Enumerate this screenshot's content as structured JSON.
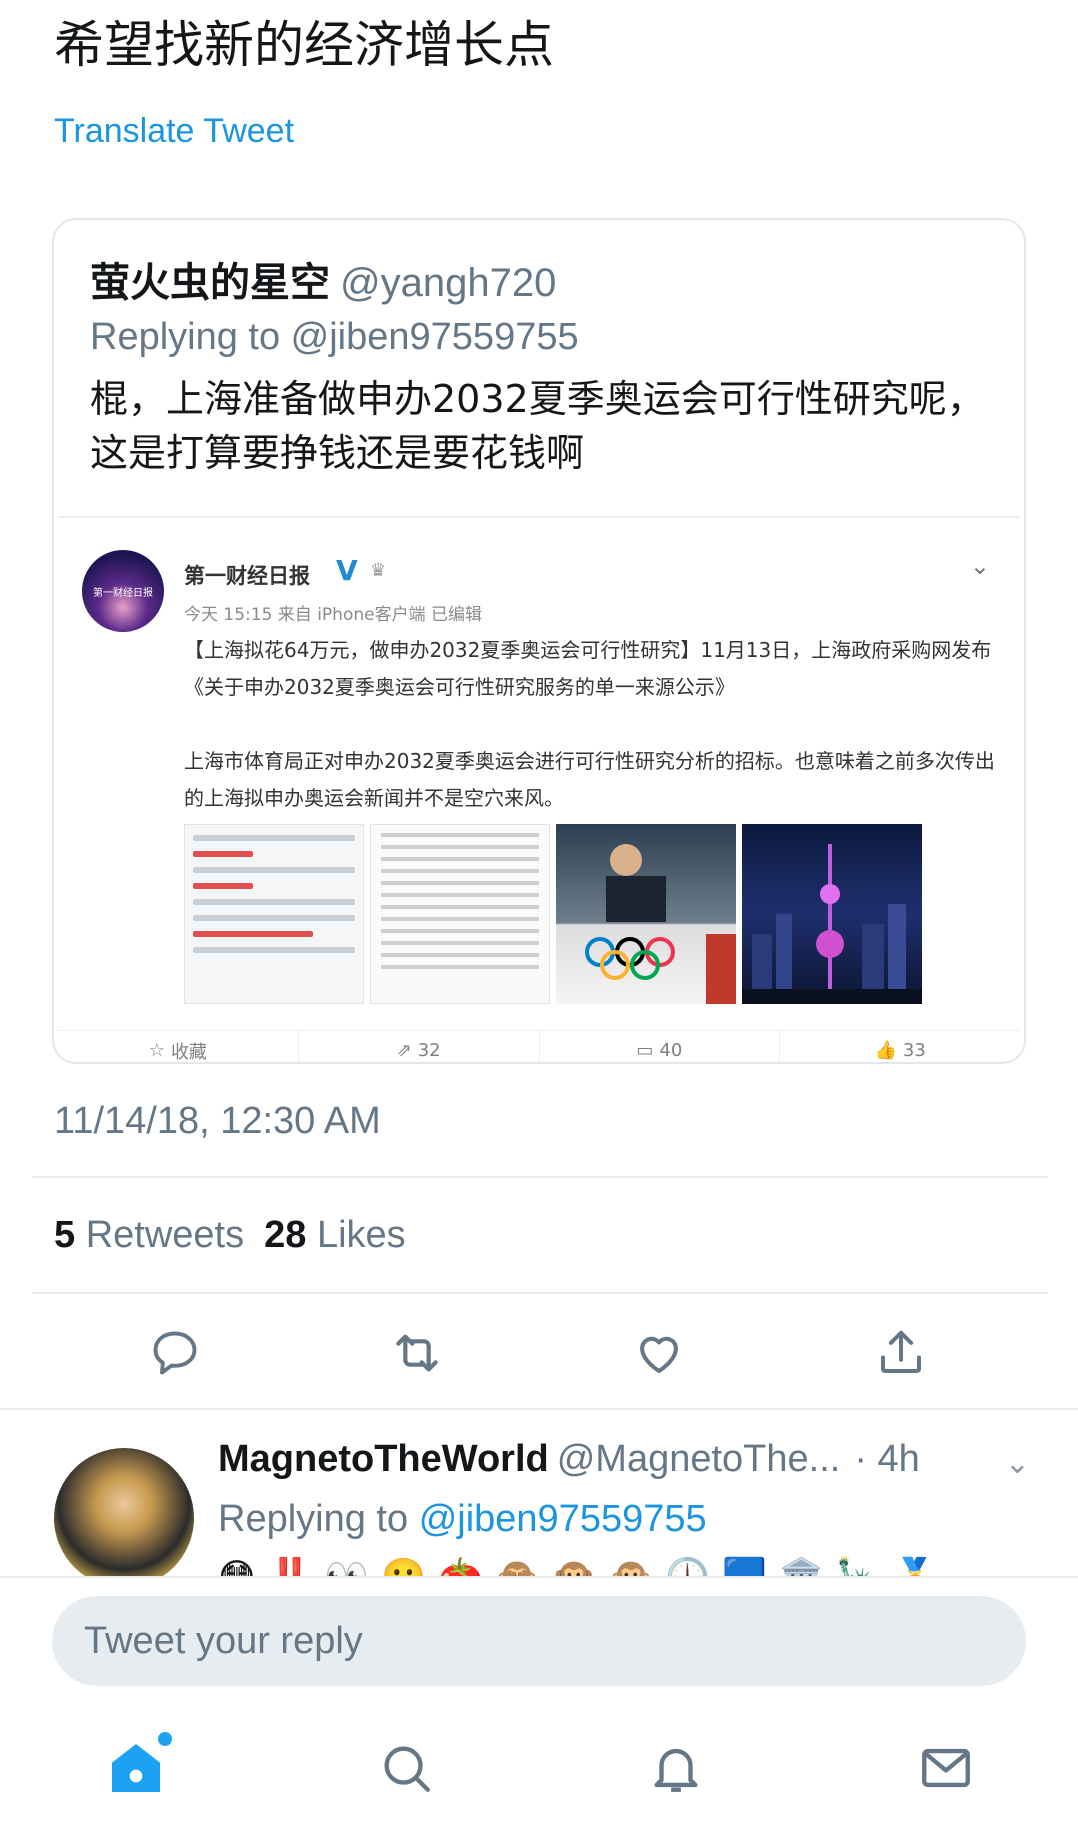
{
  "tweet": {
    "text": "希望找新的经济增长点",
    "translate_label": "Translate Tweet",
    "timestamp": "11/14/18, 12:30 AM",
    "retweets_count": "5",
    "retweets_label": "Retweets",
    "likes_count": "28",
    "likes_label": "Likes"
  },
  "quote": {
    "name": "萤火虫的星空",
    "handle": "@yangh720",
    "replying": "Replying to @jiben97559755",
    "text": "棍，上海准备做申办2032夏季奥运会可行性研究呢，这是打算要挣钱还是要花钱啊"
  },
  "weibo": {
    "avatar_text": "第一财经日报",
    "name": "第一财经日报",
    "verified_mark": "V",
    "meta": "今天 15:15 来自 iPhone客户端  已编辑",
    "para1": "【上海拟花64万元，做申办2032夏季奥运会可行性研究】11月13日，上海政府采购网发布《关于申办2032夏季奥运会可行性研究服务的单一来源公示》",
    "para2": "上海市体育局正对申办2032夏季奥运会进行可行性研究分析的招标。也意味着之前多次传出的上海拟申办奥运会新闻并不是空穴来风。",
    "actions": {
      "favorite": "收藏",
      "repost": "32",
      "comment": "40",
      "like": "33"
    }
  },
  "reply": {
    "name": "MagnetoTheWorld",
    "handle": "@MagnetoThe...",
    "time": "· 4h",
    "replying_prefix": "Replying to",
    "replying_handle": "@jiben97559755",
    "emojis": "😳‼️👀🙂🍅🙈🙉🙊🕛🟦🏛️🗽🏅"
  },
  "compose": {
    "placeholder": "Tweet your reply"
  },
  "colors": {
    "accent": "#1da1f2",
    "link": "#1b95e0",
    "muted": "#657786"
  }
}
